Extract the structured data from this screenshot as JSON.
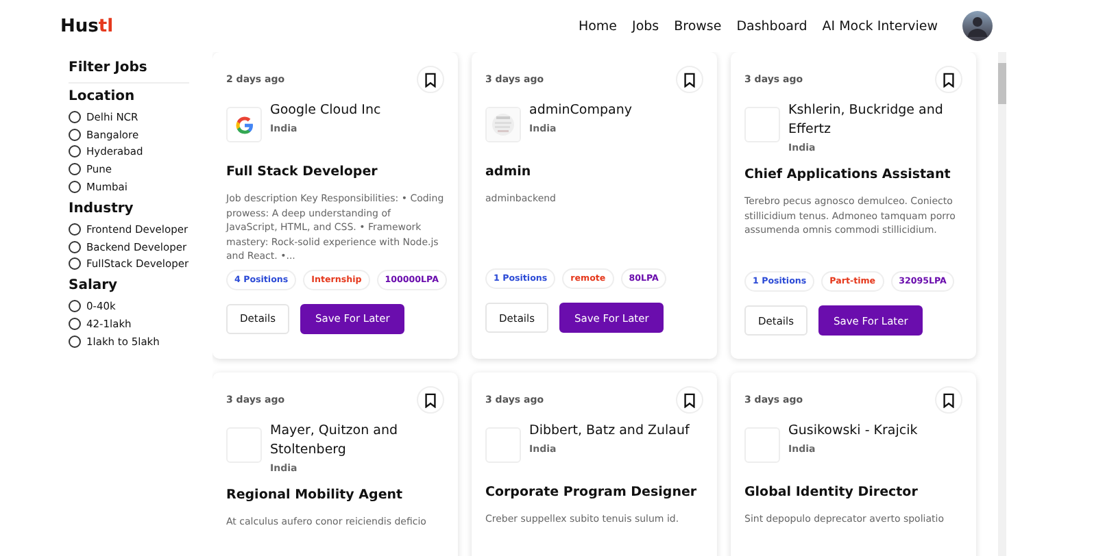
{
  "navbar": {
    "logo": {
      "main": "Hus",
      "accent": "tl"
    },
    "links": [
      "Home",
      "Jobs",
      "Browse",
      "Dashboard",
      "AI Mock Interview"
    ]
  },
  "filters": {
    "title": "Filter Jobs",
    "groups": [
      {
        "heading": "Location",
        "options": [
          {
            "label": "Delhi NCR",
            "selected": false
          },
          {
            "label": "Bangalore",
            "selected": false
          },
          {
            "label": "Hyderabad",
            "selected": false
          },
          {
            "label": "Pune",
            "selected": false
          },
          {
            "label": "Mumbai",
            "selected": false
          }
        ]
      },
      {
        "heading": "Industry",
        "options": [
          {
            "label": "Frontend Developer",
            "selected": false
          },
          {
            "label": "Backend Developer",
            "selected": false
          },
          {
            "label": "FullStack Developer",
            "selected": false
          }
        ]
      },
      {
        "heading": "Salary",
        "options": [
          {
            "label": "0-40k",
            "selected": false
          },
          {
            "label": "42-1lakh",
            "selected": false
          },
          {
            "label": "1lakh to 5lakh",
            "selected": false
          }
        ]
      }
    ]
  },
  "jobs": [
    {
      "posted": "2 days ago",
      "company_logo": {
        "kind": "google"
      },
      "company": "Google Cloud Inc",
      "location": "India",
      "title": "Full Stack Developer",
      "description": "Job description Key Responsibilities: • Coding prowess: A deep understanding of JavaScript, HTML, and CSS. • Framework mastery: Rock-solid experience with Node.js and React. •...",
      "tags": [
        "4 Positions",
        "Internship",
        "100000LPA"
      ],
      "buttons": [
        "Details",
        "Save For Later"
      ]
    },
    {
      "posted": "3 days ago",
      "company_logo": {
        "kind": "picture"
      },
      "company": "adminCompany",
      "location": "India",
      "title": "admin",
      "description": "adminbackend",
      "tags": [
        "1 Positions",
        "remote",
        "80LPA"
      ],
      "buttons": [
        "Details",
        "Save For Later"
      ]
    },
    {
      "posted": "3 days ago",
      "company_logo": {
        "kind": "blank"
      },
      "company": "Kshlerin, Buckridge and Effertz",
      "location": "India",
      "title": "Chief Applications Assistant",
      "description": "Terebro pecus agnosco demulceo. Coniecto stillicidium tenus. Admoneo tamquam porro assumenda omnis commodi stillicidium.",
      "tags": [
        "1 Positions",
        "Part-time",
        "32095LPA"
      ],
      "buttons": [
        "Details",
        "Save For Later"
      ]
    },
    {
      "posted": "3 days ago",
      "company_logo": {
        "kind": "blank"
      },
      "company": "Mayer, Quitzon and Stoltenberg",
      "location": "India",
      "title": "Regional Mobility Agent",
      "description": "At calculus aufero conor reiciendis deficio"
    },
    {
      "posted": "3 days ago",
      "company_logo": {
        "kind": "blank"
      },
      "company": "Dibbert, Batz and Zulauf",
      "location": "India",
      "title": "Corporate Program Designer",
      "description": "Creber suppellex subito tenuis sulum id."
    },
    {
      "posted": "3 days ago",
      "company_logo": {
        "kind": "blank"
      },
      "company": "Gusikowski - Krajcik",
      "location": "India",
      "title": "Global Identity Director",
      "description": "Sint depopulo deprecator averto spoliatio"
    }
  ]
}
